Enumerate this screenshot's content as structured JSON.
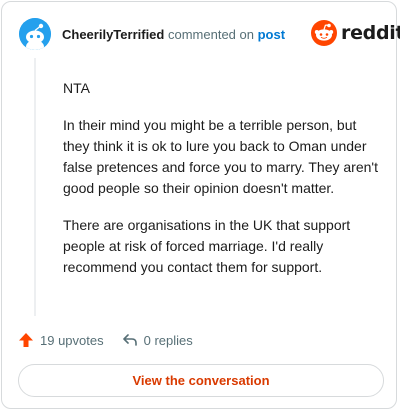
{
  "header": {
    "username": "CheerilyTerrified",
    "action_text": "commented on",
    "post_link": "post",
    "brand": "reddit"
  },
  "comment": {
    "paragraphs": [
      "NTA",
      "In their mind you might be a terrible person, but they think it is ok to lure you back to Oman under false pretences and force you to marry. They aren't good people so their opinion doesn't matter.",
      "There are organisations in the UK that support people at risk of forced marriage. I'd really recommend you contact them for support."
    ]
  },
  "actions": {
    "upvotes": "19 upvotes",
    "replies": "0 replies"
  },
  "view_button": "View the conversation",
  "colors": {
    "brand_orange": "#ff4500",
    "link_blue": "#0079d3",
    "button_text": "#d93a00",
    "avatar_bg": "#24a0ed"
  },
  "icons": {
    "avatar": "snoo-avatar-icon",
    "logo": "reddit-logo-icon",
    "upvote": "upvote-arrow-icon",
    "reply": "reply-arrow-icon"
  }
}
